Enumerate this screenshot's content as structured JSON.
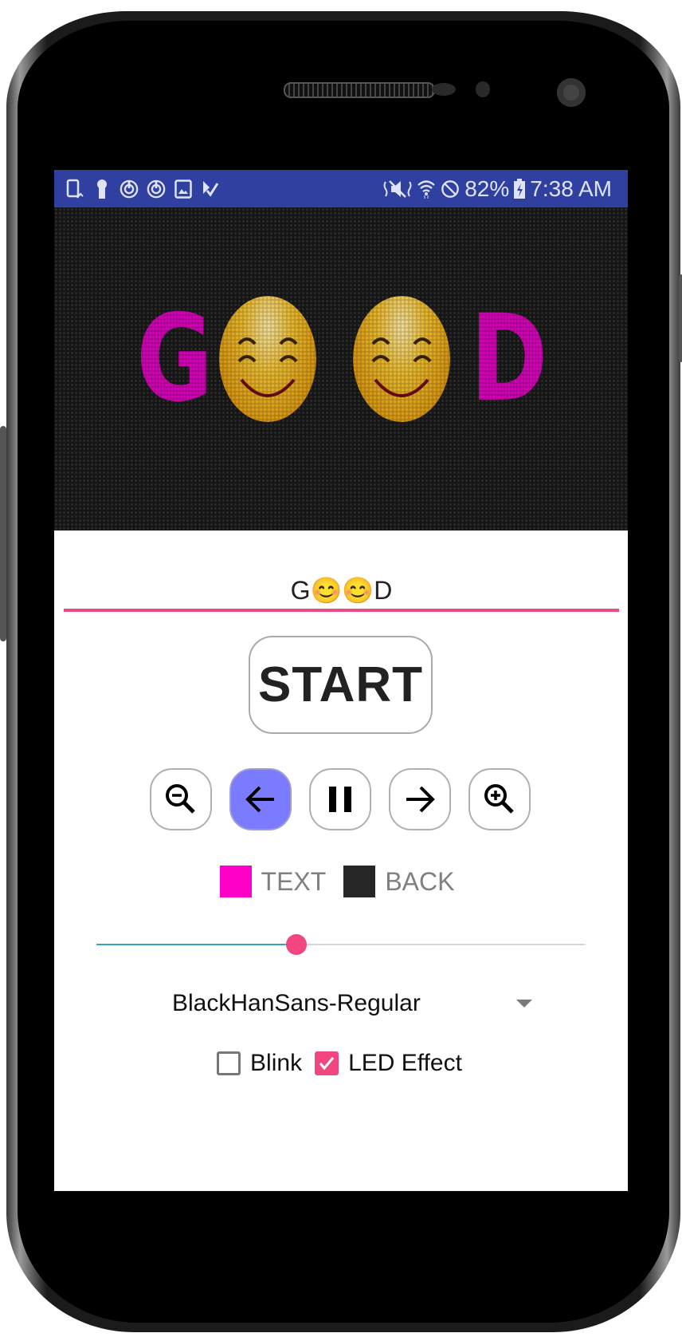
{
  "status_bar": {
    "left_icons": [
      "screen-rotate-icon",
      "keyhole-icon",
      "sync-icon",
      "sync-icon",
      "gallery-icon",
      "checkbox-flag-icon"
    ],
    "right_icons": [
      "vibrate-mute-icon",
      "wifi-icon",
      "do-not-disturb-icon"
    ],
    "battery_percent": "82%",
    "battery_icon": "battery-charging-icon",
    "time": "7:38 AM",
    "bg_color": "#3040a0"
  },
  "led_display": {
    "letters": [
      "G",
      "D"
    ],
    "emoji": "smiling-face-with-smiling-eyes",
    "text_color": "#ff00c8",
    "back_color": "#222222"
  },
  "message_input": {
    "value": "G😊😊D",
    "underline_color": "#ea4c85"
  },
  "start_button": {
    "label": "START"
  },
  "controls": [
    {
      "name": "zoom-out",
      "icon": "zoom-out-icon",
      "active": false
    },
    {
      "name": "scroll-left",
      "icon": "arrow-left-icon",
      "active": true
    },
    {
      "name": "pause",
      "icon": "pause-icon",
      "active": false
    },
    {
      "name": "scroll-right",
      "icon": "arrow-right-icon",
      "active": false
    },
    {
      "name": "zoom-in",
      "icon": "zoom-in-icon",
      "active": false
    }
  ],
  "colors": {
    "text_label": "TEXT",
    "text_color": "#ff00c8",
    "back_label": "BACK",
    "back_color": "#262626"
  },
  "speed_slider": {
    "value_fraction": 0.41,
    "fill_color": "#3aa3c7",
    "thumb_color": "#f1467f"
  },
  "font_dropdown": {
    "selected": "BlackHanSans-Regular"
  },
  "options": {
    "blink_label": "Blink",
    "blink_checked": false,
    "led_effect_label": "LED Effect",
    "led_effect_checked": true
  }
}
